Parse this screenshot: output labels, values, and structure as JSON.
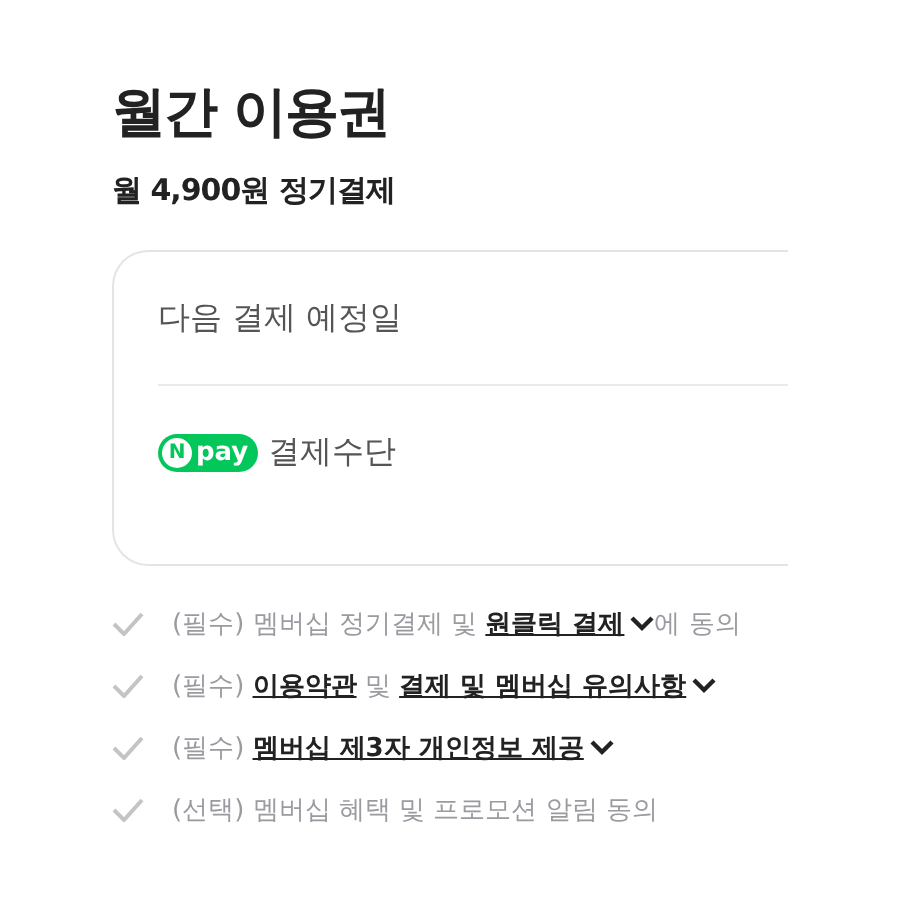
{
  "title": "월간 이용권",
  "price": "월 4,900원 정기결제",
  "card": {
    "next_payment_label": "다음 결제 예정일",
    "payment_badge": "pay",
    "payment_badge_letter": "N",
    "payment_method_label": "결제수단"
  },
  "agreements": [
    {
      "checked": false,
      "parts": [
        {
          "kind": "text",
          "text": "(필수) 멤버십 정기결제 및 "
        },
        {
          "kind": "link",
          "text": "원클릭 결제"
        },
        {
          "kind": "toggle"
        },
        {
          "kind": "text",
          "text": "에 동의"
        }
      ]
    },
    {
      "checked": false,
      "parts": [
        {
          "kind": "text",
          "text": "(필수) "
        },
        {
          "kind": "link",
          "text": "이용약관"
        },
        {
          "kind": "text",
          "text": " 및 "
        },
        {
          "kind": "link",
          "text": "결제 및 멤버십 유의사항"
        },
        {
          "kind": "toggle"
        }
      ]
    },
    {
      "checked": false,
      "parts": [
        {
          "kind": "text",
          "text": "(필수) "
        },
        {
          "kind": "link",
          "text": "멤버십 제3자 개인정보 제공"
        },
        {
          "kind": "toggle"
        }
      ]
    },
    {
      "checked": false,
      "parts": [
        {
          "kind": "text",
          "text": "(선택) 멤버십 혜택 및 프로모션 알림 동의"
        }
      ]
    }
  ]
}
